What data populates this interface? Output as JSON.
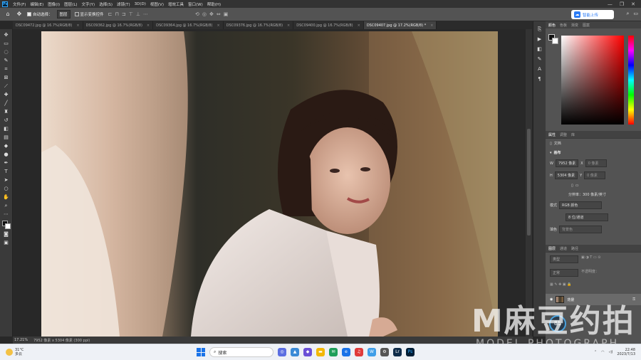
{
  "app": {
    "logo": "Ps",
    "window_controls": [
      "—",
      "❐",
      "✕"
    ]
  },
  "menu": [
    "文件(F)",
    "编辑(E)",
    "图像(I)",
    "图层(L)",
    "文字(Y)",
    "选择(S)",
    "滤镜(T)",
    "3D(D)",
    "视图(V)",
    "增效工具",
    "窗口(W)",
    "帮助(H)"
  ],
  "options": {
    "auto_select_label": "自动选择：",
    "auto_select_value": "图层",
    "show_transform_label": "显示变换控件",
    "upload_label": "智能上传"
  },
  "tabs": [
    "DSC09472.jpg @ 16.7%(RGB/8)",
    "DSC09362.jpg @ 16.7%(RGB/8)",
    "DSC09364.jpg @ 16.7%(RGB/8)",
    "DSC09376.jpg @ 16.7%(RGB/8)",
    "DSC09400.jpg @ 16.7%(RGB/8)",
    "DSC09407.jpg @ 17.2%(RGB/8) *"
  ],
  "status": {
    "zoom": "17.21%",
    "doc_info": "7952 像素 x 5304 像素 (300 ppi)"
  },
  "color_panel": {
    "tabs": [
      "颜色",
      "色板",
      "渐变",
      "图案"
    ]
  },
  "properties": {
    "tabs": [
      "属性",
      "调整",
      "库"
    ],
    "doc_label": "文档",
    "canvas_label": "画布",
    "w_label": "W",
    "w_value": "7952 像素",
    "h_label": "H",
    "h_value": "5304 像素",
    "x_label": "X",
    "x_value": "0 像素",
    "y_label": "Y",
    "y_value": "0 像素",
    "resolution": "分辨率：300 像素/英寸",
    "mode_label": "模式",
    "mode_value": "RGB 颜色",
    "depth_value": "8 位/通道",
    "fill_label": "填色",
    "fill_value": "背景色"
  },
  "layers": {
    "tabs": [
      "图层",
      "通道",
      "路径"
    ],
    "search_placeholder": "类型",
    "blend_mode": "正常",
    "opacity_label": "不透明度：",
    "layer_name": "背景",
    "perf": "85"
  },
  "watermark": {
    "big": "M麻豆约拍",
    "small": "MODEL PHOTOGRAPH"
  },
  "taskbar": {
    "weather_temp": "31°C",
    "weather_text": "多云",
    "search_label": "搜索",
    "time": "22:48",
    "date": "2023/7/13"
  }
}
